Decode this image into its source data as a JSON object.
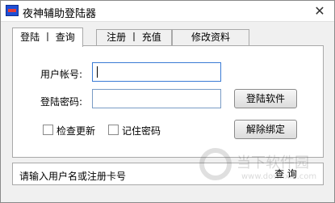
{
  "window": {
    "title": "夜神辅助登陆器",
    "close_glyph": "✕"
  },
  "tabs": [
    {
      "label": "登陆 丨 查询",
      "active": true
    },
    {
      "label": "注册 丨 充值",
      "active": false
    },
    {
      "label": "修改资料",
      "active": false
    }
  ],
  "form": {
    "username_label": "用户帐号:",
    "username_value": "",
    "password_label": "登陆密码:",
    "password_value": "",
    "login_button": "登陆软件",
    "check_update_label": "检查更新",
    "remember_password_label": "记住密码",
    "unbind_button": "解除绑定"
  },
  "status": {
    "message": "请输入用户名或注册卡号",
    "query_button": "查 询"
  },
  "watermark": {
    "text": "当下软件园",
    "url": "www.downxia.com"
  },
  "colors": {
    "input_border": "#7a9cc5",
    "titlebar_bg": "#ffffff",
    "window_bg": "#f0f0f0"
  }
}
